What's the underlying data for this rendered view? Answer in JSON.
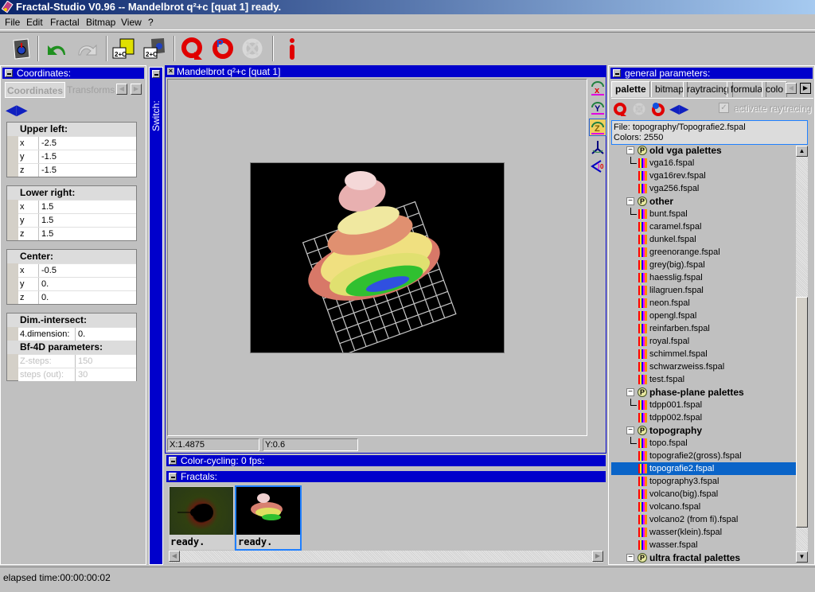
{
  "window": {
    "title": "Fractal-Studio V0.96 -- Mandelbrot q²+c [quat 1] ready."
  },
  "menu": [
    "File",
    "Edit",
    "Fractal",
    "Bitmap",
    "View",
    "?"
  ],
  "toolbar": [
    {
      "icon": "open-fractal-icon"
    },
    {
      "icon": "undo-icon"
    },
    {
      "icon": "redo-icon"
    },
    {
      "icon": "save-formula-icon"
    },
    {
      "icon": "load-formula-icon"
    },
    {
      "icon": "recalculate-icon"
    },
    {
      "icon": "recalculate-p-icon"
    },
    {
      "icon": "stop-icon"
    },
    {
      "icon": "info-icon"
    }
  ],
  "coordinates": {
    "header": "Coordinates:",
    "tabs": [
      "Coordinates",
      "Transforms"
    ],
    "upper_left": {
      "label": "Upper left:",
      "x": "-2.5",
      "y": "-1.5",
      "z": "-1.5"
    },
    "lower_right": {
      "label": "Lower right:",
      "x": "1.5",
      "y": "1.5",
      "z": "1.5"
    },
    "center": {
      "label": "Center:",
      "x": "-0.5",
      "y": "0.",
      "z": "0."
    },
    "axis_labels": {
      "x": "x",
      "y": "y",
      "z": "z"
    },
    "dim_intersect": {
      "label": "Dim.-intersect:",
      "field_label": "4.dimension:",
      "value": "0."
    },
    "bf4d": {
      "label": "Bf-4D parameters:",
      "zsteps_label": "Z-steps:",
      "zsteps": "150",
      "steps_out_label": "steps (out):",
      "steps_out": "30"
    }
  },
  "switch_label": "Switch:",
  "fractal_window": {
    "title": "Mandelbrot q²+c [quat 1]",
    "status_x": "X:1.4875",
    "status_y": "Y:0.6"
  },
  "color_cycling": {
    "header": "Color-cycling: 0 fps:"
  },
  "fractals": {
    "header": "Fractals:",
    "items": [
      {
        "status": "ready.",
        "kind": "mandelbrot-2d"
      },
      {
        "status": "ready.",
        "kind": "quaternion-3d",
        "selected": true
      }
    ]
  },
  "general_parameters": {
    "header": "general parameters:",
    "tabs": [
      "palette",
      "bitmap",
      "raytracing",
      "formula",
      "colo"
    ],
    "active_tab": "palette",
    "activate_raytracing": "activate raytracing",
    "file_info": "File: topography/Topografie2.fspal",
    "colors_info": "Colors: 2550",
    "tree": [
      {
        "type": "folder",
        "label": "old vga palettes"
      },
      {
        "type": "file",
        "label": "vga16.fspal",
        "first": true
      },
      {
        "type": "file",
        "label": "vga16rev.fspal"
      },
      {
        "type": "file",
        "label": "vga256.fspal"
      },
      {
        "type": "folder",
        "label": "other"
      },
      {
        "type": "file",
        "label": "bunt.fspal",
        "first": true
      },
      {
        "type": "file",
        "label": "caramel.fspal"
      },
      {
        "type": "file",
        "label": "dunkel.fspal"
      },
      {
        "type": "file",
        "label": "greenorange.fspal"
      },
      {
        "type": "file",
        "label": "grey(big).fspal"
      },
      {
        "type": "file",
        "label": "haesslig.fspal"
      },
      {
        "type": "file",
        "label": "lilagruen.fspal"
      },
      {
        "type": "file",
        "label": "neon.fspal"
      },
      {
        "type": "file",
        "label": "opengl.fspal"
      },
      {
        "type": "file",
        "label": "reinfarben.fspal"
      },
      {
        "type": "file",
        "label": "royal.fspal"
      },
      {
        "type": "file",
        "label": "schimmel.fspal"
      },
      {
        "type": "file",
        "label": "schwarzweiss.fspal"
      },
      {
        "type": "file",
        "label": "test.fspal"
      },
      {
        "type": "folder",
        "label": "phase-plane palettes"
      },
      {
        "type": "file",
        "label": "tdpp001.fspal",
        "first": true
      },
      {
        "type": "file",
        "label": "tdpp002.fspal"
      },
      {
        "type": "folder",
        "label": "topography"
      },
      {
        "type": "file",
        "label": "topo.fspal",
        "first": true
      },
      {
        "type": "file",
        "label": "topografie2(gross).fspal"
      },
      {
        "type": "file",
        "label": "topografie2.fspal",
        "selected": true
      },
      {
        "type": "file",
        "label": "topography3.fspal"
      },
      {
        "type": "file",
        "label": "volcano(big).fspal"
      },
      {
        "type": "file",
        "label": "volcano.fspal"
      },
      {
        "type": "file",
        "label": "volcano2 (from fi).fspal"
      },
      {
        "type": "file",
        "label": "wasser(klein).fspal"
      },
      {
        "type": "file",
        "label": "wasser.fspal"
      },
      {
        "type": "folder",
        "label": "ultra fractal palettes"
      }
    ]
  },
  "statusbar": {
    "elapsed": "elapsed time:00:00:00:02"
  }
}
